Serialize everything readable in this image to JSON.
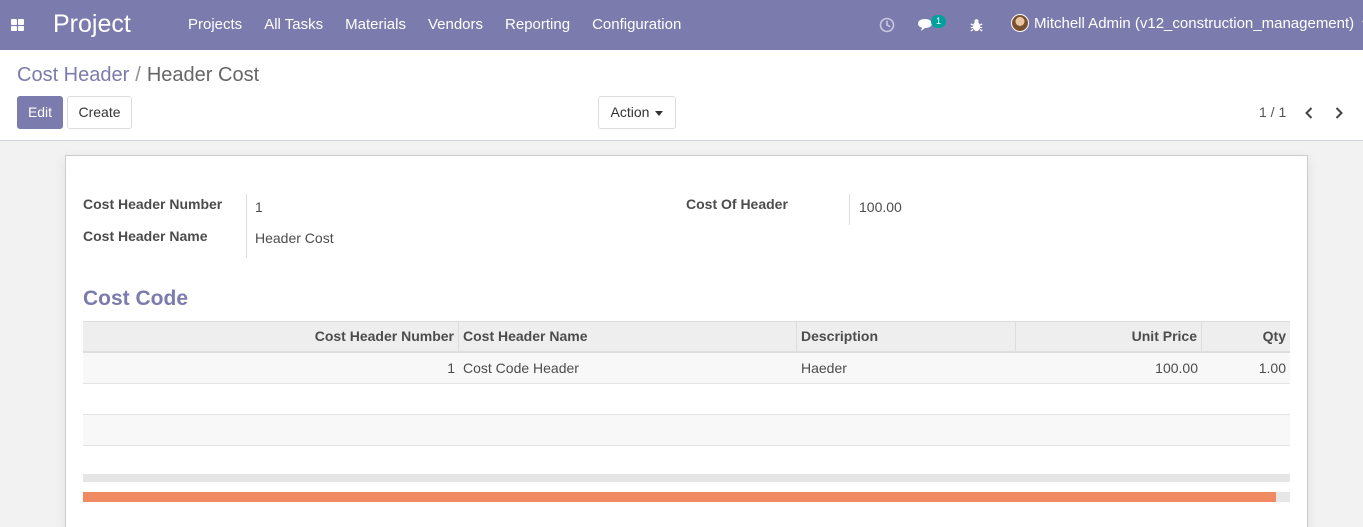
{
  "navbar": {
    "brand": "Project",
    "menu": [
      "Projects",
      "All Tasks",
      "Materials",
      "Vendors",
      "Reporting",
      "Configuration"
    ],
    "chat_badge": "1",
    "user_name": "Mitchell Admin (v12_construction_management)"
  },
  "breadcrumb": {
    "parent": "Cost Header",
    "separator": "/",
    "current": "Header Cost"
  },
  "buttons": {
    "edit": "Edit",
    "create": "Create",
    "action": "Action"
  },
  "pager": {
    "text": "1 / 1"
  },
  "form": {
    "cost_header_number_label": "Cost Header Number",
    "cost_header_number": "1",
    "cost_header_name_label": "Cost Header Name",
    "cost_header_name": "Header Cost",
    "cost_of_header_label": "Cost Of Header",
    "cost_of_header": "100.00"
  },
  "cost_code": {
    "title": "Cost Code",
    "columns": [
      "Cost Header Number",
      "Cost Header Name",
      "Description",
      "Unit Price",
      "Qty"
    ],
    "rows": [
      [
        "1",
        "Cost Code Header",
        "Haeder",
        "100.00",
        "1.00"
      ]
    ]
  },
  "colors": {
    "primary": "#7c7bad",
    "badge": "#00a09d",
    "scroll_accent": "#f08a63"
  },
  "icons": [
    "apps-icon",
    "clock-icon",
    "chat-icon",
    "bug-icon",
    "chevron-left-icon",
    "chevron-right-icon"
  ]
}
